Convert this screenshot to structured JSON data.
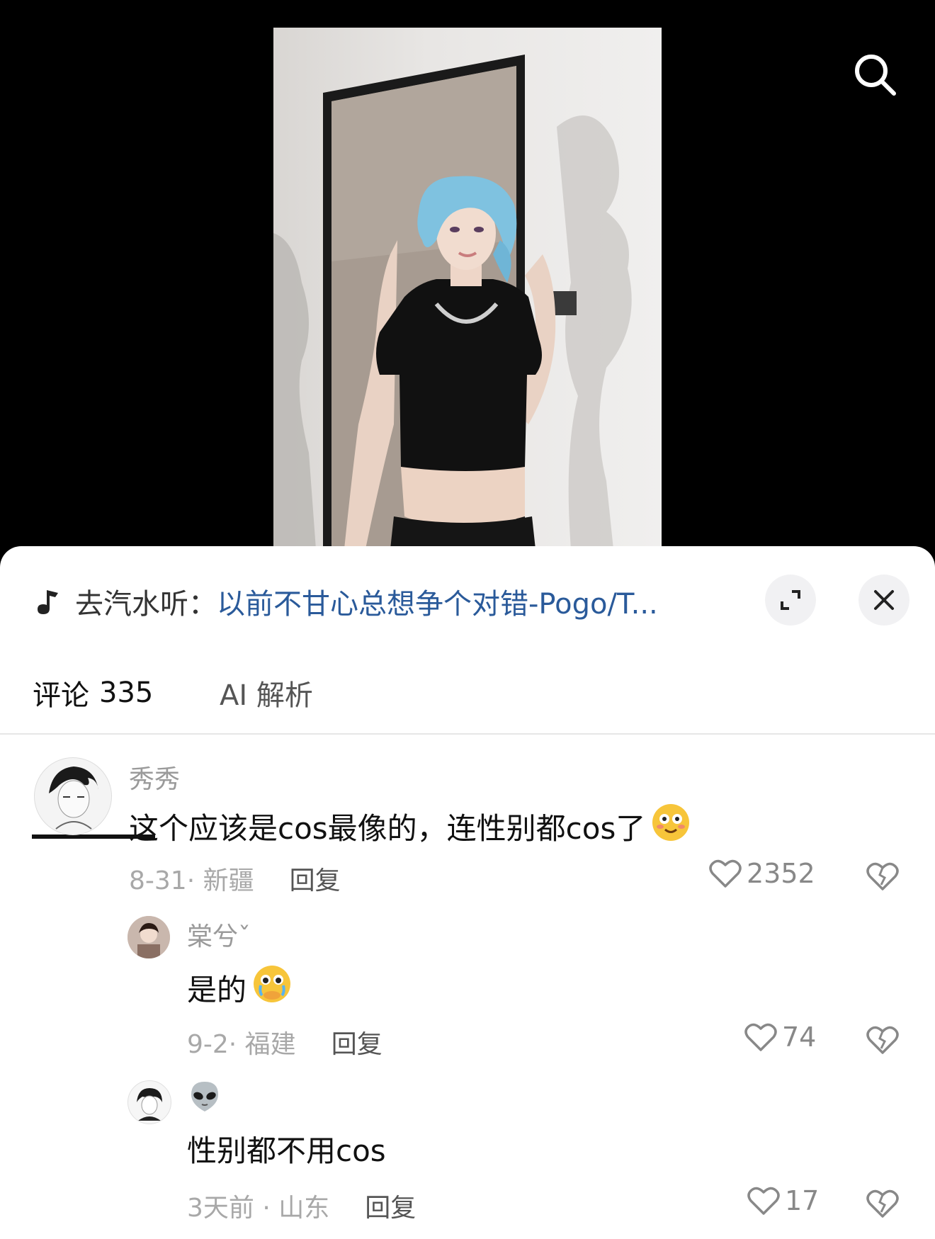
{
  "music": {
    "prefix": "去汽水听：",
    "title": "以前不甘心总想争个对错-Pogo/T..."
  },
  "tabs": {
    "comments_label": "评论",
    "comments_count": "335",
    "ai_label": "AI 解析"
  },
  "comments": [
    {
      "author": "秀秀",
      "text": "这个应该是cos最像的，连性别都cos了",
      "date_location": "8-31· 新疆",
      "reply_label": "回复",
      "likes": "2352",
      "emoji": "flushed-smile-emoji"
    },
    {
      "author": "棠兮ˇ",
      "text": "是的",
      "date_location": "9-2· 福建",
      "reply_label": "回复",
      "likes": "74",
      "emoji": "pleading-tears-emoji"
    },
    {
      "author_emoji": "alien-emoji",
      "text": "性别都不用cos",
      "date_location": "3天前 · 山东",
      "reply_label": "回复",
      "likes": "17"
    }
  ],
  "colors": {
    "link_blue": "#2a5a9a",
    "muted_gray": "#a8a8a8",
    "text_black": "#111111",
    "sheet_bg": "#ffffff",
    "video_bg": "#000000"
  }
}
